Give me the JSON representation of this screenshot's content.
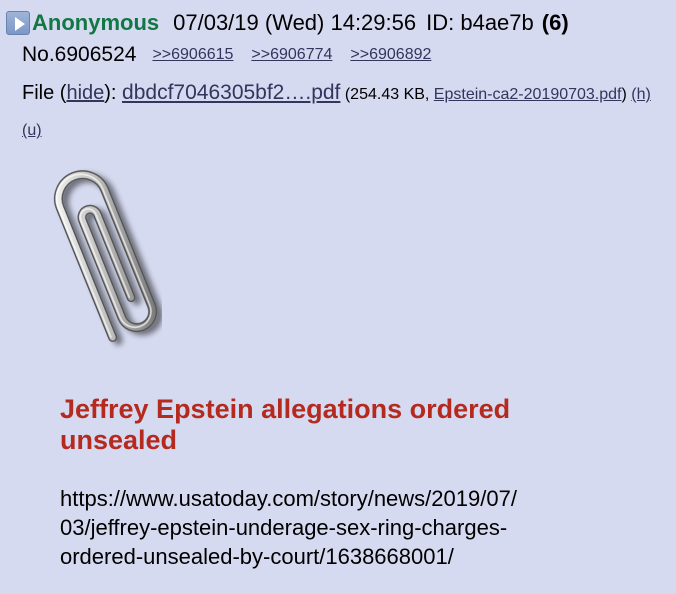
{
  "post": {
    "name": "Anonymous",
    "datetime": "07/03/19 (Wed) 14:29:56",
    "id_label": "ID: b4ae7b",
    "reply_count": "(6)",
    "post_number": "No.6906524",
    "backlinks": [
      ">>6906615",
      ">>6906774",
      ">>6906892"
    ],
    "file": {
      "label_prefix": "File (",
      "hide": "hide",
      "label_sep": "): ",
      "filename": "dbdcf7046305bf2….pdf",
      "size_prefix": " (254.43 KB, ",
      "original_name": "Epstein-ca2-20190703.pdf",
      "close_paren": ") ",
      "h": "(h)",
      "u": "(u)"
    },
    "subject": "Jeffrey Epstein allegations ordered unsealed",
    "url_lines": [
      "https://www.usatoday.com/story/news/2019/07/",
      "03/jeffrey-epstein-underage-sex-ring-charges-",
      "ordered-unsealed-by-court/1638668001/"
    ]
  },
  "icons": {
    "toggle": "expand-triangle-icon",
    "thumbnail": "paperclip-icon"
  },
  "colors": {
    "background": "#d6daf0",
    "name": "#117743",
    "subject": "#b52a1f",
    "link": "#34345c"
  }
}
